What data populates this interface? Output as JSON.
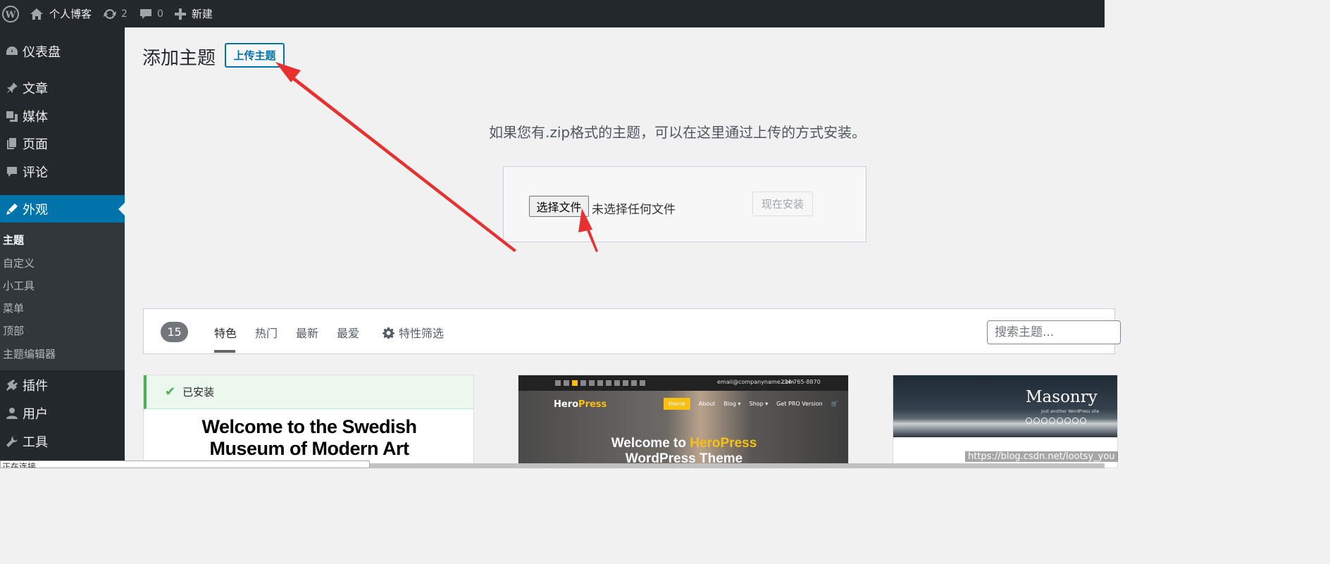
{
  "admin_bar": {
    "site_name": "个人博客",
    "updates_count": "2",
    "comments_count": "0",
    "new_label": "新建"
  },
  "sidebar": {
    "menu": [
      {
        "label": "仪表盘",
        "icon": "dashboard-icon"
      },
      {
        "label": "文章",
        "icon": "pin-icon"
      },
      {
        "label": "媒体",
        "icon": "media-icon"
      },
      {
        "label": "页面",
        "icon": "page-icon"
      },
      {
        "label": "评论",
        "icon": "comment-icon"
      },
      {
        "label": "外观",
        "icon": "appearance-icon",
        "current": true
      },
      {
        "label": "插件",
        "icon": "plugin-icon"
      },
      {
        "label": "用户",
        "icon": "user-icon"
      },
      {
        "label": "工具",
        "icon": "wrench-icon"
      }
    ],
    "submenu": [
      {
        "label": "主题",
        "current": true
      },
      {
        "label": "自定义"
      },
      {
        "label": "小工具"
      },
      {
        "label": "菜单"
      },
      {
        "label": "顶部"
      },
      {
        "label": "主题编辑器"
      }
    ]
  },
  "header": {
    "title": "添加主题",
    "upload_button": "上传主题"
  },
  "upload": {
    "description": "如果您有.zip格式的主题，可以在这里通过上传的方式安装。",
    "choose_file_button": "选择文件",
    "no_file_text": "未选择任何文件",
    "install_button": "现在安装"
  },
  "filter": {
    "count": "15",
    "tabs": [
      "特色",
      "热门",
      "最新",
      "最爱"
    ],
    "feature_filter": "特性筛选",
    "search_placeholder": "搜索主题..."
  },
  "themes": [
    {
      "installed_label": "已安装",
      "preview_title_line1": "Welcome to the Swedish",
      "preview_title_line2": "Museum of Modern Art"
    },
    {
      "preview_logo_a": "Hero",
      "preview_logo_b": "Press",
      "preview_email": "email@companyname.com",
      "preview_phone": "234-765-8870",
      "preview_nav": [
        "Home",
        "About",
        "Blog ▾",
        "Shop ▾",
        "Get PRO Version"
      ],
      "preview_title_a": "Welcome to ",
      "preview_title_b": "HeroPress",
      "preview_title_line2": "WordPress Theme"
    },
    {
      "preview_title": "Masonry",
      "preview_subtitle": "Just another WordPress site"
    }
  ],
  "status_bar": "正在连接...",
  "watermark": "https://blog.csdn.net/lootsy_you",
  "colors": {
    "admin_dark": "#23282d",
    "accent": "#0073aa",
    "installed_green": "#46b450",
    "annotation_red": "#e8312f",
    "heropress_yellow": "#f9bf13"
  }
}
